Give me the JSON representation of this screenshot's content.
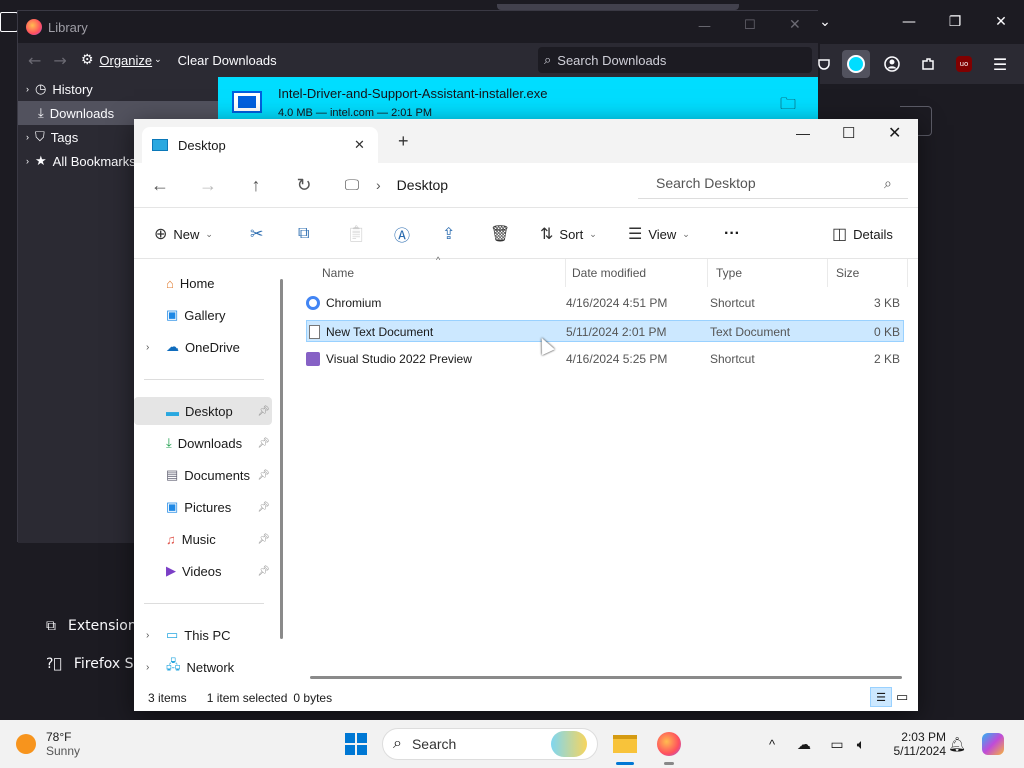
{
  "firefox": {
    "menu": [
      {
        "label": "Extensions",
        "icon": "puzzle-icon"
      },
      {
        "label": "Firefox Su",
        "icon": "help-icon"
      }
    ]
  },
  "library": {
    "title": "Library",
    "toolbar": {
      "organize": "Organize",
      "clear": "Clear Downloads"
    },
    "search_placeholder": "Search Downloads",
    "tree": [
      {
        "label": "History"
      },
      {
        "label": "Downloads",
        "selected": true
      },
      {
        "label": "Tags"
      },
      {
        "label": "All Bookmarks"
      }
    ],
    "download": {
      "name": "Intel-Driver-and-Support-Assistant-installer.exe",
      "meta": "4.0 MB — intel.com — 2:01 PM"
    }
  },
  "explorer": {
    "tab_title": "Desktop",
    "breadcrumb": "Desktop",
    "search_placeholder": "Search Desktop",
    "commands": {
      "new": "New",
      "sort": "Sort",
      "view": "View",
      "more": "···",
      "details": "Details"
    },
    "pane": {
      "quick": [
        {
          "label": "Home"
        },
        {
          "label": "Gallery"
        },
        {
          "label": "OneDrive"
        }
      ],
      "pinned": [
        {
          "label": "Desktop",
          "selected": true
        },
        {
          "label": "Downloads"
        },
        {
          "label": "Documents"
        },
        {
          "label": "Pictures"
        },
        {
          "label": "Music"
        },
        {
          "label": "Videos"
        }
      ],
      "places": [
        {
          "label": "This PC"
        },
        {
          "label": "Network"
        }
      ]
    },
    "columns": {
      "name": "Name",
      "date": "Date modified",
      "type": "Type",
      "size": "Size"
    },
    "files": [
      {
        "name": "Chromium",
        "date": "4/16/2024 4:51 PM",
        "type": "Shortcut",
        "size": "3 KB"
      },
      {
        "name": "New Text Document",
        "date": "5/11/2024 2:01 PM",
        "type": "Text Document",
        "size": "0 KB",
        "selected": true
      },
      {
        "name": "Visual Studio 2022 Preview",
        "date": "4/16/2024 5:25 PM",
        "type": "Shortcut",
        "size": "2 KB"
      }
    ],
    "status": {
      "count": "3 items",
      "selected": "1 item selected",
      "bytes": "0 bytes"
    }
  },
  "taskbar": {
    "weather": {
      "temp": "78°F",
      "condition": "Sunny"
    },
    "search": "Search",
    "clock": {
      "time": "2:03 PM",
      "date": "5/11/2024"
    }
  }
}
